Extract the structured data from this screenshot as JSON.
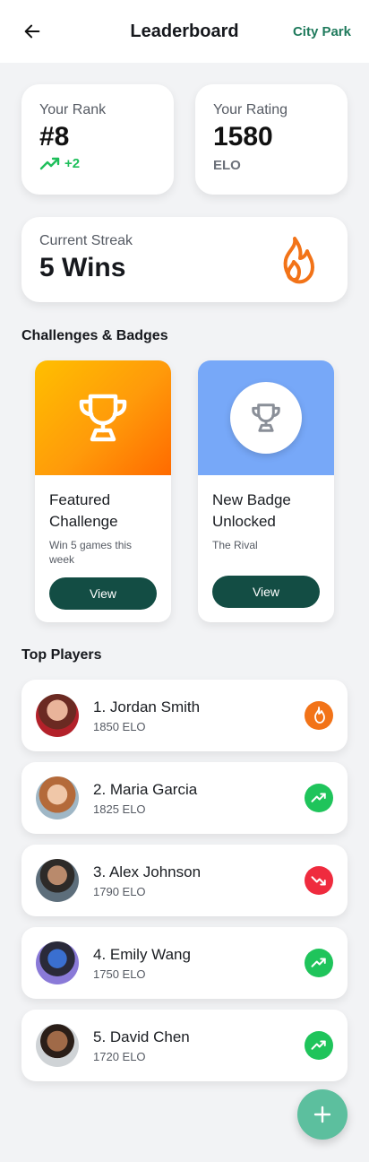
{
  "header": {
    "title": "Leaderboard",
    "location": "City Park"
  },
  "stats": {
    "rank": {
      "label": "Your Rank",
      "value": "#8",
      "delta": "+2"
    },
    "rating": {
      "label": "Your Rating",
      "value": "1580",
      "unit": "ELO"
    },
    "streak": {
      "label": "Current Streak",
      "value": "5 Wins"
    }
  },
  "sections": {
    "challenges": "Challenges & Badges",
    "top_players": "Top Players"
  },
  "cards": [
    {
      "title": "Featured Challenge",
      "subtitle": "Win 5 games this week",
      "button": "View"
    },
    {
      "title": "New Badge Unlocked",
      "subtitle": "The Rival",
      "button": "View"
    }
  ],
  "players": [
    {
      "name": "1. Jordan Smith",
      "elo": "1850 ELO",
      "trend": "fire-icon",
      "color": "#f27318"
    },
    {
      "name": "2. Maria Garcia",
      "elo": "1825 ELO",
      "trend": "trend-up-icon",
      "color": "#1fc45b"
    },
    {
      "name": "3. Alex Johnson",
      "elo": "1790 ELO",
      "trend": "trend-down-icon",
      "color": "#ef2b3e"
    },
    {
      "name": "4. Emily Wang",
      "elo": "1750 ELO",
      "trend": "trend-up-icon",
      "color": "#1fc45b"
    },
    {
      "name": "5. David Chen",
      "elo": "1720 ELO",
      "trend": "trend-up-icon",
      "color": "#1fc45b"
    }
  ],
  "colors": {
    "accent": "#134d44",
    "fab": "#5cbf9e",
    "orange": "#f27318",
    "blue": "#77a8f8"
  }
}
